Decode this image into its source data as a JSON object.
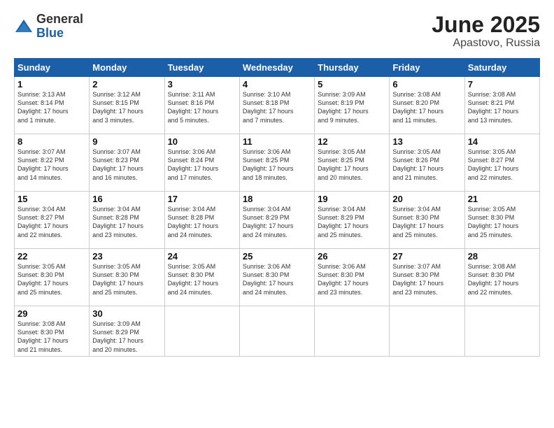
{
  "header": {
    "logo_general": "General",
    "logo_blue": "Blue",
    "month_title": "June 2025",
    "location": "Apastovo, Russia"
  },
  "weekdays": [
    "Sunday",
    "Monday",
    "Tuesday",
    "Wednesday",
    "Thursday",
    "Friday",
    "Saturday"
  ],
  "weeks": [
    [
      {
        "day": 1,
        "info": "Sunrise: 3:13 AM\nSunset: 8:14 PM\nDaylight: 17 hours\nand 1 minute."
      },
      {
        "day": 2,
        "info": "Sunrise: 3:12 AM\nSunset: 8:15 PM\nDaylight: 17 hours\nand 3 minutes."
      },
      {
        "day": 3,
        "info": "Sunrise: 3:11 AM\nSunset: 8:16 PM\nDaylight: 17 hours\nand 5 minutes."
      },
      {
        "day": 4,
        "info": "Sunrise: 3:10 AM\nSunset: 8:18 PM\nDaylight: 17 hours\nand 7 minutes."
      },
      {
        "day": 5,
        "info": "Sunrise: 3:09 AM\nSunset: 8:19 PM\nDaylight: 17 hours\nand 9 minutes."
      },
      {
        "day": 6,
        "info": "Sunrise: 3:08 AM\nSunset: 8:20 PM\nDaylight: 17 hours\nand 11 minutes."
      },
      {
        "day": 7,
        "info": "Sunrise: 3:08 AM\nSunset: 8:21 PM\nDaylight: 17 hours\nand 13 minutes."
      }
    ],
    [
      {
        "day": 8,
        "info": "Sunrise: 3:07 AM\nSunset: 8:22 PM\nDaylight: 17 hours\nand 14 minutes."
      },
      {
        "day": 9,
        "info": "Sunrise: 3:07 AM\nSunset: 8:23 PM\nDaylight: 17 hours\nand 16 minutes."
      },
      {
        "day": 10,
        "info": "Sunrise: 3:06 AM\nSunset: 8:24 PM\nDaylight: 17 hours\nand 17 minutes."
      },
      {
        "day": 11,
        "info": "Sunrise: 3:06 AM\nSunset: 8:25 PM\nDaylight: 17 hours\nand 18 minutes."
      },
      {
        "day": 12,
        "info": "Sunrise: 3:05 AM\nSunset: 8:25 PM\nDaylight: 17 hours\nand 20 minutes."
      },
      {
        "day": 13,
        "info": "Sunrise: 3:05 AM\nSunset: 8:26 PM\nDaylight: 17 hours\nand 21 minutes."
      },
      {
        "day": 14,
        "info": "Sunrise: 3:05 AM\nSunset: 8:27 PM\nDaylight: 17 hours\nand 22 minutes."
      }
    ],
    [
      {
        "day": 15,
        "info": "Sunrise: 3:04 AM\nSunset: 8:27 PM\nDaylight: 17 hours\nand 22 minutes."
      },
      {
        "day": 16,
        "info": "Sunrise: 3:04 AM\nSunset: 8:28 PM\nDaylight: 17 hours\nand 23 minutes."
      },
      {
        "day": 17,
        "info": "Sunrise: 3:04 AM\nSunset: 8:28 PM\nDaylight: 17 hours\nand 24 minutes."
      },
      {
        "day": 18,
        "info": "Sunrise: 3:04 AM\nSunset: 8:29 PM\nDaylight: 17 hours\nand 24 minutes."
      },
      {
        "day": 19,
        "info": "Sunrise: 3:04 AM\nSunset: 8:29 PM\nDaylight: 17 hours\nand 25 minutes."
      },
      {
        "day": 20,
        "info": "Sunrise: 3:04 AM\nSunset: 8:30 PM\nDaylight: 17 hours\nand 25 minutes."
      },
      {
        "day": 21,
        "info": "Sunrise: 3:05 AM\nSunset: 8:30 PM\nDaylight: 17 hours\nand 25 minutes."
      }
    ],
    [
      {
        "day": 22,
        "info": "Sunrise: 3:05 AM\nSunset: 8:30 PM\nDaylight: 17 hours\nand 25 minutes."
      },
      {
        "day": 23,
        "info": "Sunrise: 3:05 AM\nSunset: 8:30 PM\nDaylight: 17 hours\nand 25 minutes."
      },
      {
        "day": 24,
        "info": "Sunrise: 3:05 AM\nSunset: 8:30 PM\nDaylight: 17 hours\nand 24 minutes."
      },
      {
        "day": 25,
        "info": "Sunrise: 3:06 AM\nSunset: 8:30 PM\nDaylight: 17 hours\nand 24 minutes."
      },
      {
        "day": 26,
        "info": "Sunrise: 3:06 AM\nSunset: 8:30 PM\nDaylight: 17 hours\nand 23 minutes."
      },
      {
        "day": 27,
        "info": "Sunrise: 3:07 AM\nSunset: 8:30 PM\nDaylight: 17 hours\nand 23 minutes."
      },
      {
        "day": 28,
        "info": "Sunrise: 3:08 AM\nSunset: 8:30 PM\nDaylight: 17 hours\nand 22 minutes."
      }
    ],
    [
      {
        "day": 29,
        "info": "Sunrise: 3:08 AM\nSunset: 8:30 PM\nDaylight: 17 hours\nand 21 minutes."
      },
      {
        "day": 30,
        "info": "Sunrise: 3:09 AM\nSunset: 8:29 PM\nDaylight: 17 hours\nand 20 minutes."
      },
      null,
      null,
      null,
      null,
      null
    ]
  ]
}
